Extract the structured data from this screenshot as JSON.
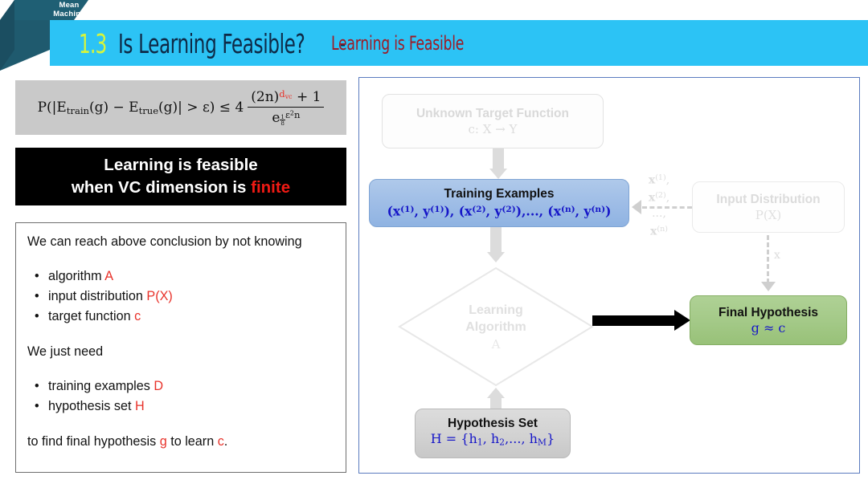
{
  "logo": {
    "line1": "Mean",
    "line2": "Machine"
  },
  "header": {
    "number": "1.3",
    "title": "Is Learning Feasible?",
    "dash": "-",
    "subtitle": "Learning is Feasible",
    "banner_color": "#2CC3F5",
    "number_color": "#D6F53C",
    "title_color": "#0E2A47",
    "subtitle_color": "#9E1B26"
  },
  "formula": {
    "lhs": "P(|E",
    "sub1": "train",
    "mid1": "(g) − E",
    "sub2": "true",
    "mid2": "(g)| > ε) ≤ 4",
    "numerator_base": "(2n)",
    "numerator_exp": "d",
    "numerator_exp_sub": "vc",
    "numerator_tail": " + 1",
    "denominator_base": "e",
    "denominator_frac_num": "1",
    "denominator_frac_den": "8",
    "denominator_tail": "ε",
    "denominator_tail_sup": "2",
    "denominator_tail2": "n",
    "exponent_color": "#E8322A",
    "background": "#C9C9C9"
  },
  "conclusion_box": {
    "line1": "Learning is feasible",
    "line2_prefix": "when VC dimension is ",
    "line2_highlight": "finite",
    "background": "#000000",
    "text_color": "#FFFFFF",
    "highlight_color": "#F01A14"
  },
  "notes_box": {
    "intro": "We can reach above conclusion by not knowing",
    "bullets_1": [
      {
        "bullet": "•",
        "text": "algorithm ",
        "highlight": "A"
      },
      {
        "bullet": "•",
        "text": "input distribution ",
        "highlight": "P(X)"
      },
      {
        "bullet": "•",
        "text": "target function ",
        "highlight": "c"
      }
    ],
    "middle": "We just need",
    "bullets_2": [
      {
        "bullet": "•",
        "text": "training examples ",
        "highlight": "D"
      },
      {
        "bullet": "•",
        "text": "hypothesis set ",
        "highlight": "H"
      }
    ],
    "closing_p1": "to find final hypothesis ",
    "closing_h1": "g",
    "closing_p2": " to learn ",
    "closing_h2": "c",
    "closing_p3": ".",
    "highlight_color": "#E8322A"
  },
  "diagram": {
    "border_color": "#5B7BBF",
    "nodes": {
      "target_function": {
        "title": "Unknown Target Function",
        "subtitle": "c: X → Y",
        "state": "faded"
      },
      "training_examples": {
        "title": "Training Examples",
        "subtitle": "(𝐱(1), y(1)), (𝐱(2), y(2)),..., (𝐱(n), y(n))",
        "state": "active",
        "fill": "#9DBCE6",
        "text_color": "#1616C8"
      },
      "input_distribution": {
        "title": "Input Distribution",
        "subtitle": "P(X)",
        "state": "faded"
      },
      "learning_algorithm": {
        "title_line1": "Learning",
        "title_line2": "Algorithm",
        "subtitle": "A",
        "state": "faded",
        "shape": "diamond"
      },
      "final_hypothesis": {
        "title": "Final Hypothesis",
        "subtitle": "g ≈ c",
        "state": "active",
        "fill": "#A3C987",
        "text_color": "#1616C8"
      },
      "hypothesis_set": {
        "title": "Hypothesis Set",
        "subtitle": "H = {h1, h2,..., hM}",
        "state": "active",
        "fill": "#D2D2D2",
        "text_color": "#1616C8"
      }
    },
    "edge_labels": {
      "samples_list": [
        "𝐱(1),",
        "𝐱(2),",
        "...,",
        "𝐱(n)"
      ],
      "x_label": "x"
    }
  }
}
